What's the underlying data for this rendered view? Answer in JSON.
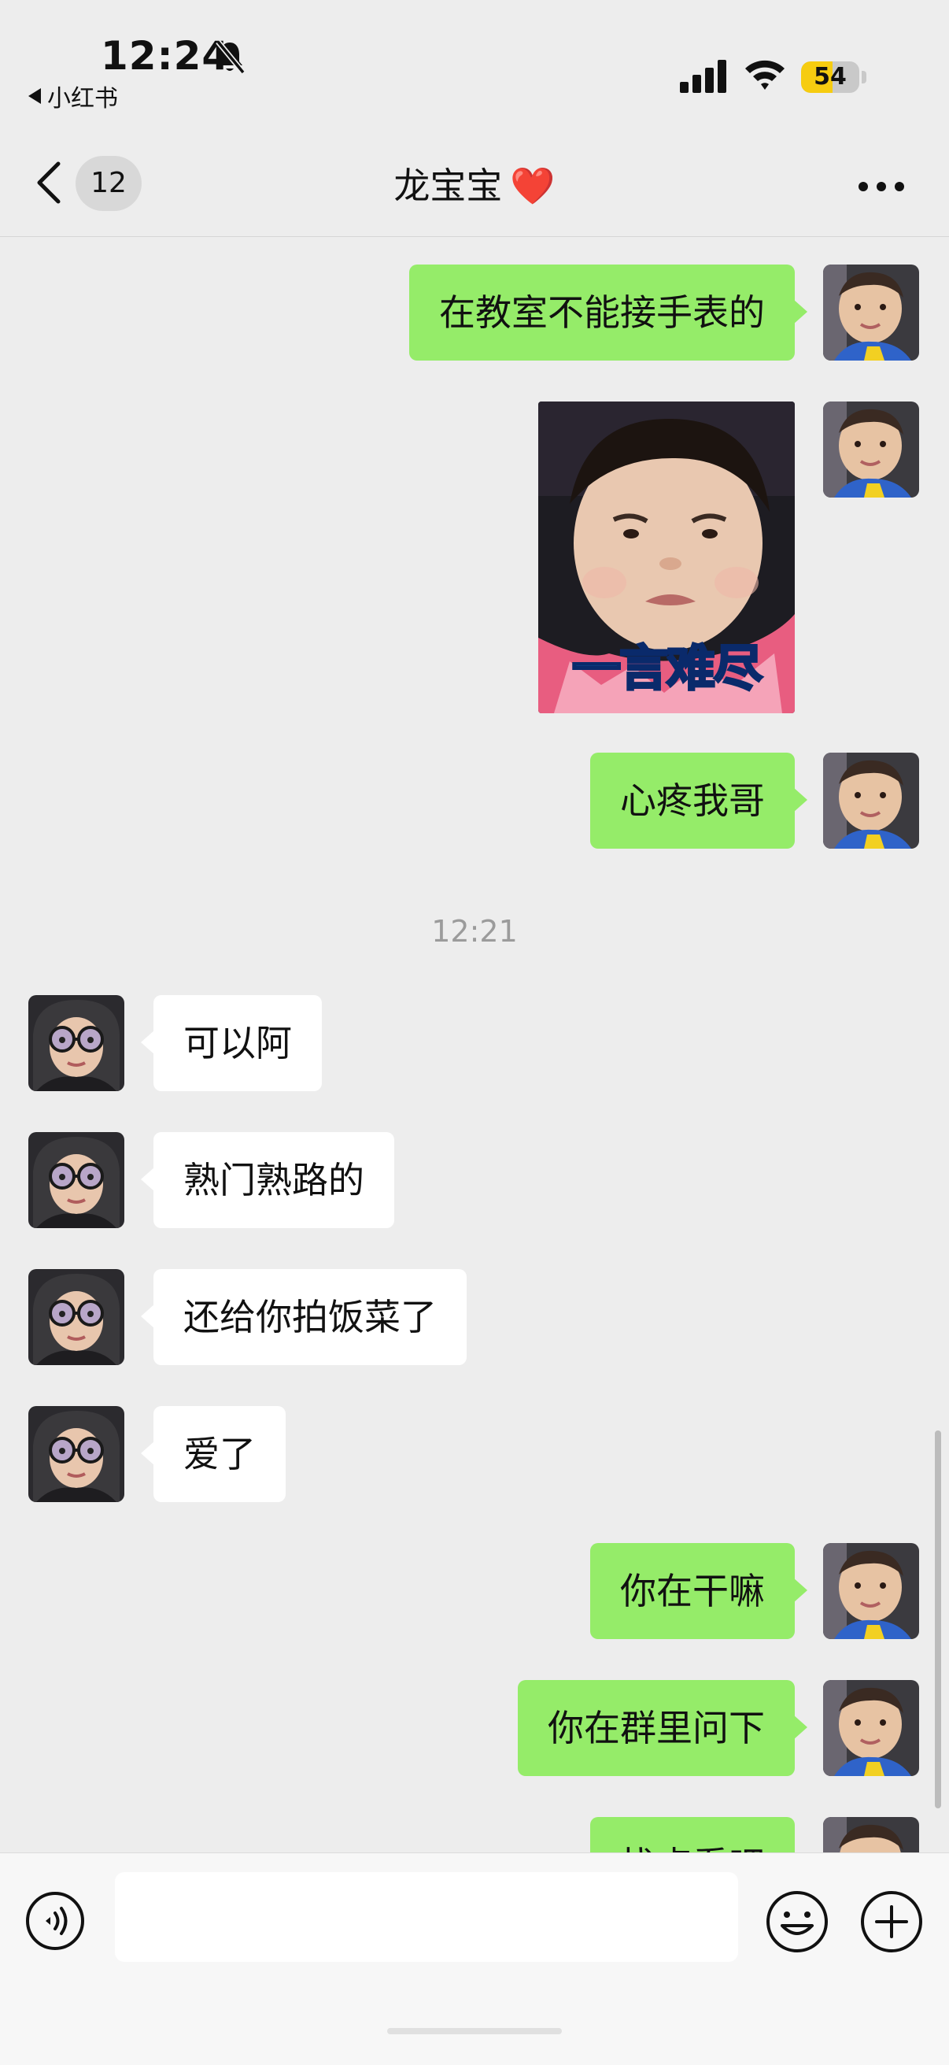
{
  "status_bar": {
    "time": "12:24",
    "back_app": "小红书",
    "battery": "54",
    "battery_level": 0.54,
    "icons": [
      "bell-slash-icon",
      "signal-icon",
      "wifi-icon",
      "battery-icon"
    ]
  },
  "nav": {
    "unread_count": "12",
    "title": "龙宝宝",
    "title_emoji": "❤️",
    "icons": [
      "chevron-left-icon",
      "more-icon"
    ]
  },
  "chat": {
    "timestamp": "12:21",
    "sticker_caption": "一言难尽",
    "messages": [
      {
        "from": "me",
        "text": "在教室不能接手表的"
      },
      {
        "from": "me",
        "type": "sticker"
      },
      {
        "from": "me",
        "text": "心疼我哥"
      },
      {
        "from": "them",
        "text": "可以阿"
      },
      {
        "from": "them",
        "text": "熟门熟路的"
      },
      {
        "from": "them",
        "text": "还给你拍饭菜了"
      },
      {
        "from": "them",
        "text": "爱了"
      },
      {
        "from": "me",
        "text": "你在干嘛"
      },
      {
        "from": "me",
        "text": "你在群里问下"
      }
    ],
    "partial_message": "找点看吧"
  },
  "input_bar": {
    "value": "",
    "icons": [
      "voice-icon",
      "emoji-icon",
      "plus-icon"
    ]
  },
  "colors": {
    "background": "#ededed",
    "my_bubble": "#95ec69",
    "their_bubble": "#ffffff",
    "battery": "#f6cc10",
    "heart": "#e8212a"
  }
}
